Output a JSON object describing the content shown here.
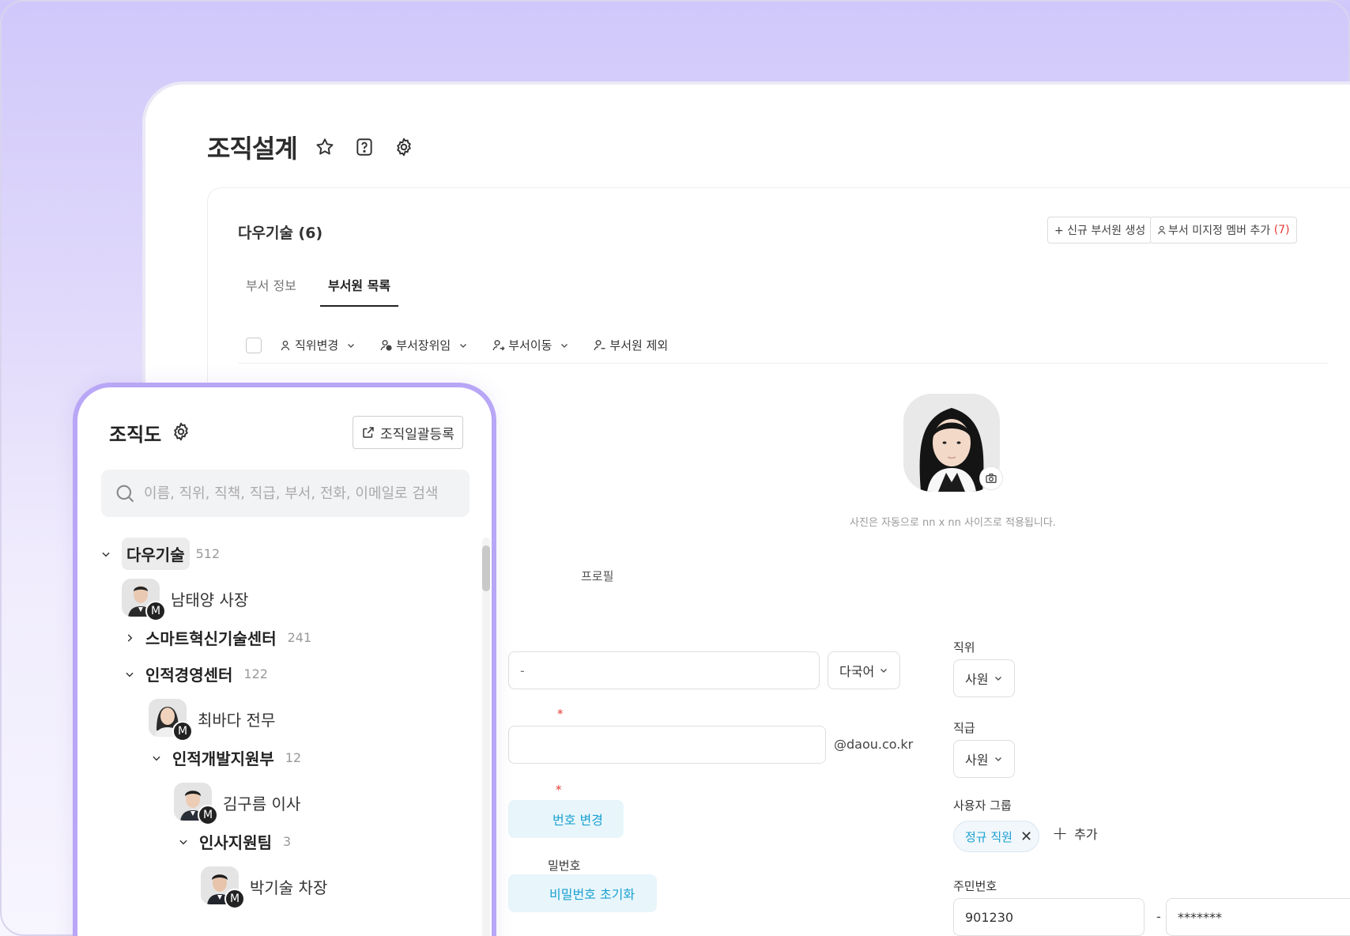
{
  "page": {
    "title": "조직설계"
  },
  "card": {
    "dept_title": "다우기술 (6)",
    "new_member_btn": "+ 신규 부서원 생성",
    "unassigned_btn_prefix": "부서 미지정 멤버 추가",
    "unassigned_count": "(7)",
    "tabs": [
      {
        "label": "부서 정보",
        "active": false
      },
      {
        "label": "부서원 목록",
        "active": true
      }
    ],
    "toolbar": {
      "change_position": "직위변경",
      "assign_head": "부서장위임",
      "move_dept": "부서이동",
      "remove_member": "부서원 제외"
    }
  },
  "profile": {
    "photo_note": "사진은 자동으로 nn x nn 사이즈로 적용됩니다.",
    "section_label": "프로필",
    "name_lang_select": "다국어",
    "email_domain": "@daou.co.kr",
    "change_pw_btn": "번호 변경",
    "pw_label_partial": "밀번호",
    "reset_pw_btn": "비밀번호 초기화",
    "position_label": "직위",
    "position_value": "사원",
    "grade_label": "직급",
    "grade_value": "사원",
    "user_group_label": "사용자 그룹",
    "user_group_chip": "정규 직원",
    "add_label": "추가",
    "rrn_label": "주민번호",
    "rrn_front": "901230",
    "rrn_dash": "-",
    "rrn_back": "*******"
  },
  "org": {
    "title": "조직도",
    "bulk_btn": "조직일괄등록",
    "search_placeholder": "이름, 직위, 직책, 직급, 부서, 전화, 이메일로 검색",
    "tree": {
      "root_name": "다우기술",
      "root_count": "512",
      "person1": "남태양 사장",
      "dept_smart": "스마트혁신기술센터",
      "dept_smart_count": "241",
      "dept_hr": "인적경영센터",
      "dept_hr_count": "122",
      "person2": "최바다 전무",
      "dept_hrdev": "인적개발지원부",
      "dept_hrdev_count": "12",
      "person3": "김구름 이사",
      "dept_team": "인사지원팀",
      "dept_team_count": "3",
      "person4": "박기술 차장",
      "badge": "M"
    }
  },
  "colors": {
    "accent_purple": "#b8a6f6",
    "link_blue": "#1aa0d2",
    "required_red": "#e53935"
  }
}
